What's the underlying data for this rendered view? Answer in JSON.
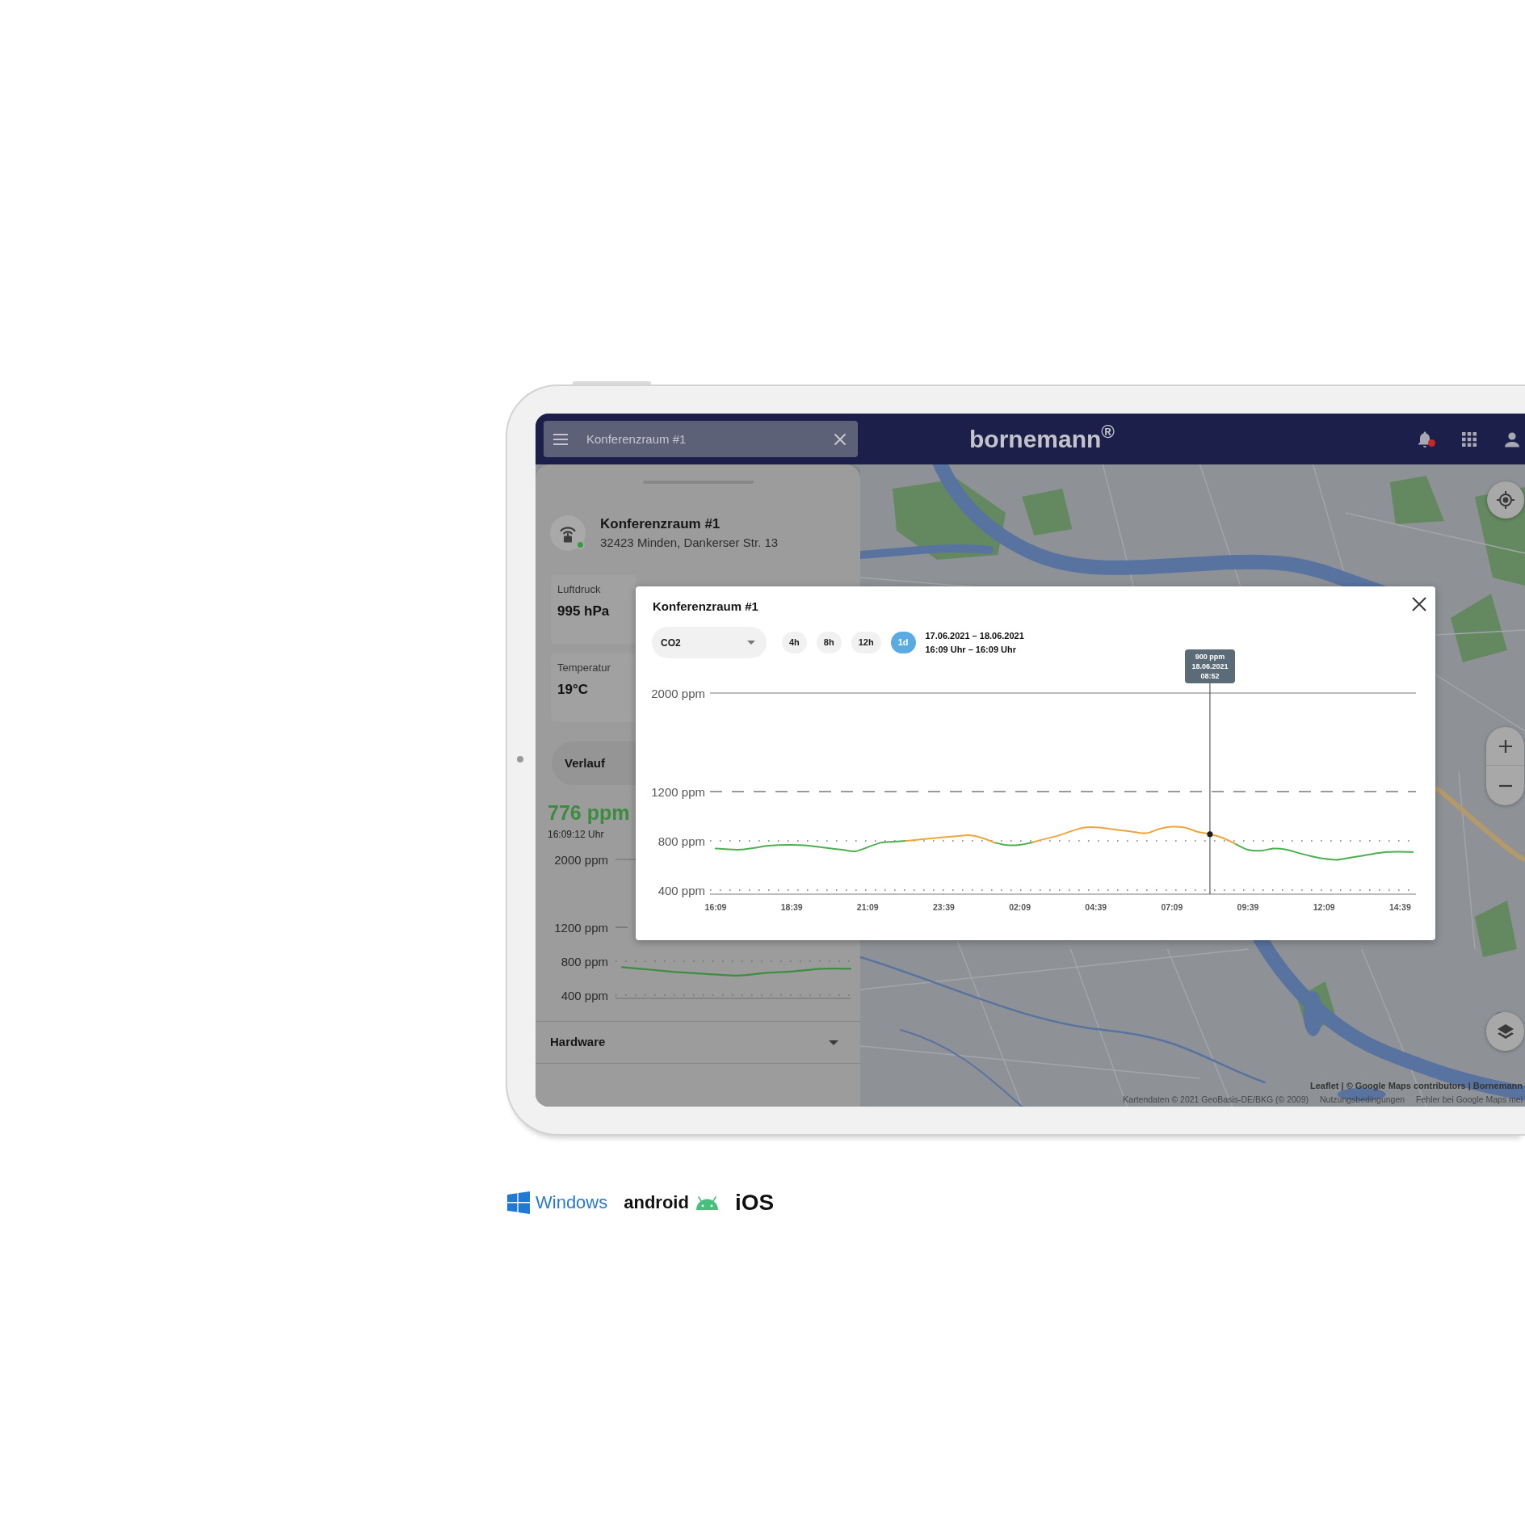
{
  "topbar": {
    "search_value": "Konferenzraum #1",
    "brand": "bornemann$^{®}$",
    "has_notifications": true
  },
  "location_panel": {
    "title": "Konferenzraum #1",
    "address": "32423 Minden, Dankerser Str. 13",
    "online": true,
    "metrics": [
      {
        "label": "Luftdruck",
        "value": "995 hPa"
      },
      {
        "label": "Temperatur",
        "value": "19°C"
      }
    ],
    "tabs": [
      {
        "label": "Verlauf",
        "selected": true
      }
    ],
    "current_reading": {
      "value": "776 ppm",
      "time": "16:09:12 Uhr"
    },
    "chart_data": {
      "type": "line",
      "series": [
        {
          "color": "#3e8e41",
          "values": [
            730,
            700,
            670,
            650,
            630,
            660,
            680,
            710,
            710
          ]
        }
      ],
      "ylim": [
        400,
        2000
      ],
      "yticks": [
        {
          "value": 2000,
          "label": "2000 ppm"
        },
        {
          "value": 1200,
          "label": "1200 ppm"
        },
        {
          "value": 800,
          "label": "800 ppm"
        },
        {
          "value": 400,
          "label": "400 ppm"
        }
      ]
    },
    "sections": [
      {
        "label": "Hardware",
        "expanded": false
      }
    ]
  },
  "map": {
    "attribution": "Leaflet | © Google Maps contributors | Bornemann",
    "footer_links": [
      "Kartendaten © 2021 GeoBasis-DE/BKG (© 2009)",
      "Nutzungsbedingungen",
      "Fehler bei Google Maps mel"
    ]
  },
  "chart_dialog": {
    "title": "Konferenzraum #1",
    "metric": "CO2",
    "ranges": [
      {
        "label": "4h",
        "selected": false
      },
      {
        "label": "8h",
        "selected": false
      },
      {
        "label": "12h",
        "selected": false
      },
      {
        "label": "1d",
        "selected": true
      }
    ],
    "date_range": [
      "17.06.2021 – 18.06.2021",
      "16:09 Uhr – 16:09 Uhr"
    ],
    "chart_data": {
      "type": "line",
      "categories": [
        "16:09",
        null,
        null,
        null,
        null,
        null,
        "18:39",
        null,
        null,
        null,
        null,
        null,
        "21:09",
        null,
        null,
        null,
        null,
        null,
        "23:39",
        null,
        null,
        null,
        null,
        null,
        "02:09",
        null,
        null,
        null,
        null,
        null,
        "04:39",
        null,
        null,
        null,
        null,
        null,
        "07:09",
        null,
        null,
        null,
        null,
        null,
        "09:39",
        null,
        null,
        null,
        null,
        null,
        "12:09",
        null,
        null,
        null,
        null,
        null,
        "14:39",
        null
      ],
      "series": [
        {
          "color": "#4caf50",
          "values": [
            738,
            731,
            729,
            742,
            759,
            766,
            768,
            764,
            753,
            739,
            727,
            715,
            748,
            784,
            793,
            800,
            null,
            null,
            null,
            null,
            null,
            null,
            786,
            765,
            767,
            788,
            null,
            null,
            null,
            null,
            null,
            null,
            null,
            null,
            null,
            null,
            null,
            null,
            null,
            null,
            null,
            776,
            728,
            720,
            737,
            730,
            701,
            676,
            655,
            646,
            663,
            679,
            697,
            710,
            712,
            709
          ]
        },
        {
          "color": "#f0a53a",
          "values": [
            null,
            null,
            null,
            null,
            null,
            null,
            null,
            null,
            null,
            null,
            null,
            null,
            null,
            null,
            null,
            800,
            810,
            820,
            829,
            838,
            845,
            825,
            786,
            null,
            null,
            788,
            816,
            842,
            876,
            907,
            910,
            899,
            886,
            872,
            863,
            897,
            914,
            908,
            874,
            854,
            825,
            776,
            null,
            null,
            null,
            null,
            null,
            null,
            null,
            null,
            null,
            null,
            null,
            null,
            null,
            null
          ]
        },
        {
          "color": "#1e1e1e",
          "marker": "circle",
          "values": [
            null,
            null,
            null,
            null,
            null,
            null,
            null,
            null,
            null,
            null,
            null,
            null,
            null,
            null,
            null,
            null,
            null,
            null,
            null,
            null,
            null,
            null,
            null,
            null,
            null,
            null,
            null,
            null,
            null,
            null,
            null,
            null,
            null,
            null,
            null,
            null,
            null,
            null,
            null,
            854,
            null,
            null,
            null,
            null,
            null,
            null,
            null,
            null,
            null,
            null,
            null,
            null,
            null,
            null,
            null,
            null
          ]
        }
      ],
      "ylim": [
        400,
        2000
      ],
      "yticks": [
        {
          "value": 2000,
          "label": "2000 ppm"
        },
        {
          "value": 1200,
          "label": "1200 ppm"
        },
        {
          "value": 800,
          "label": "800 ppm"
        },
        {
          "value": 400,
          "label": "400 ppm"
        }
      ],
      "annotations": [
        "900 ppm\n18.06.2021\n08:52"
      ]
    }
  },
  "platforms": [
    {
      "kind": "windows",
      "label": "Windows"
    },
    {
      "kind": "android",
      "label": "android"
    },
    {
      "kind": "ios",
      "label": "iOS"
    }
  ]
}
